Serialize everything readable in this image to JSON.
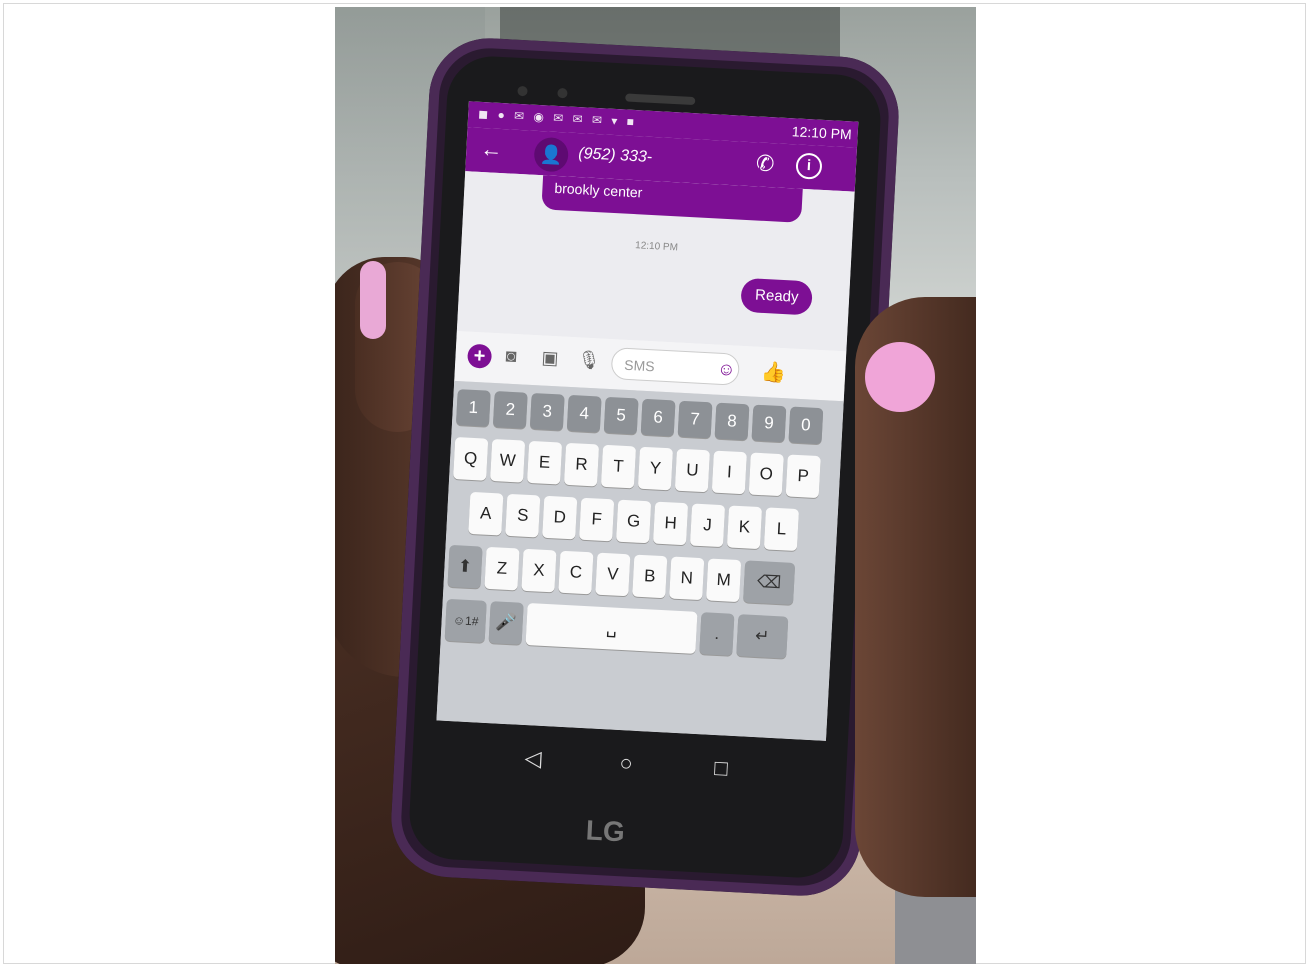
{
  "statusbar": {
    "time": "12:10 PM"
  },
  "conversation": {
    "contact": "(952) 333-",
    "incoming_text": "brookly center",
    "timestamp": "12:10 PM",
    "outgoing_text": "Ready"
  },
  "composer": {
    "placeholder": "SMS"
  },
  "keyboard": {
    "numbers": [
      "1",
      "2",
      "3",
      "4",
      "5",
      "6",
      "7",
      "8",
      "9",
      "0"
    ],
    "row1": [
      "Q",
      "W",
      "E",
      "R",
      "T",
      "Y",
      "U",
      "I",
      "O",
      "P"
    ],
    "row2": [
      "A",
      "S",
      "D",
      "F",
      "G",
      "H",
      "J",
      "K",
      "L"
    ],
    "row3": [
      "Z",
      "X",
      "C",
      "V",
      "B",
      "N",
      "M"
    ],
    "symbols_label": "☺1#"
  },
  "phone": {
    "brand": "LG"
  },
  "colors": {
    "accent": "#7d0f94",
    "nail": "#f0a5d8"
  }
}
